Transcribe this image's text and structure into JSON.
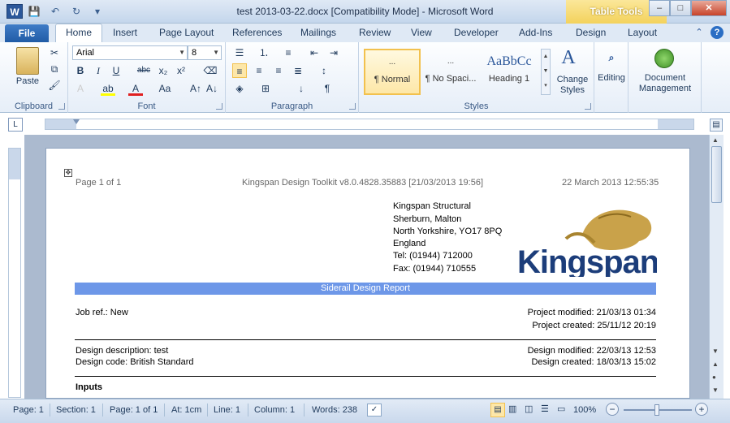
{
  "window": {
    "title": "test 2013-03-22.docx [Compatibility Mode]  -  Microsoft Word",
    "app_icon": "W",
    "contextual_tab_group": "Table Tools"
  },
  "tabs": {
    "file": "File",
    "items": [
      "Home",
      "Insert",
      "Page Layout",
      "References",
      "Mailings",
      "Review",
      "View",
      "Developer",
      "Add-Ins",
      "Design",
      "Layout"
    ],
    "active": "Home"
  },
  "ribbon": {
    "clipboard": {
      "label": "Clipboard",
      "paste": "Paste"
    },
    "font": {
      "label": "Font",
      "family": "Arial",
      "size": "8"
    },
    "paragraph": {
      "label": "Paragraph"
    },
    "styles": {
      "label": "Styles",
      "items": [
        {
          "preview": "...",
          "name": "¶ Normal"
        },
        {
          "preview": "...",
          "name": "¶ No Spaci..."
        },
        {
          "preview": "AaBbCc",
          "name": "Heading 1"
        }
      ],
      "change_styles": "Change Styles"
    },
    "editing": {
      "label": "Editing"
    },
    "document_management": {
      "label": "Document Management"
    }
  },
  "document": {
    "header_left": "Page 1 of 1",
    "header_center": "Kingspan Design Toolkit v8.0.4828.35883 [21/03/2013 19:56]",
    "header_right": "22 March 2013 12:55:35",
    "address": [
      "Kingspan Structural",
      "Sherburn, Malton",
      "North Yorkshire, YO17 8PQ",
      "England",
      "Tel: (01944) 712000",
      "Fax: (01944) 710555"
    ],
    "logo_text": "Kingspan",
    "report_title": "Siderail Design Report",
    "job_ref": "Job ref.: New",
    "project_modified": "Project modified: 21/03/13 01:34",
    "project_created": "Project created: 25/11/12 20:19",
    "design_description": "Design description: test",
    "design_code": "Design code:  British Standard",
    "design_modified": "Design modified: 22/03/13 12:53",
    "design_created": "Design created: 18/03/13 15:02",
    "inputs_heading": "Inputs"
  },
  "status": {
    "page": "Page: 1",
    "section": "Section: 1",
    "page_of": "Page: 1 of 1",
    "at": "At: 1cm",
    "line": "Line: 1",
    "column": "Column: 1",
    "words": "Words: 238",
    "zoom": "100%"
  }
}
